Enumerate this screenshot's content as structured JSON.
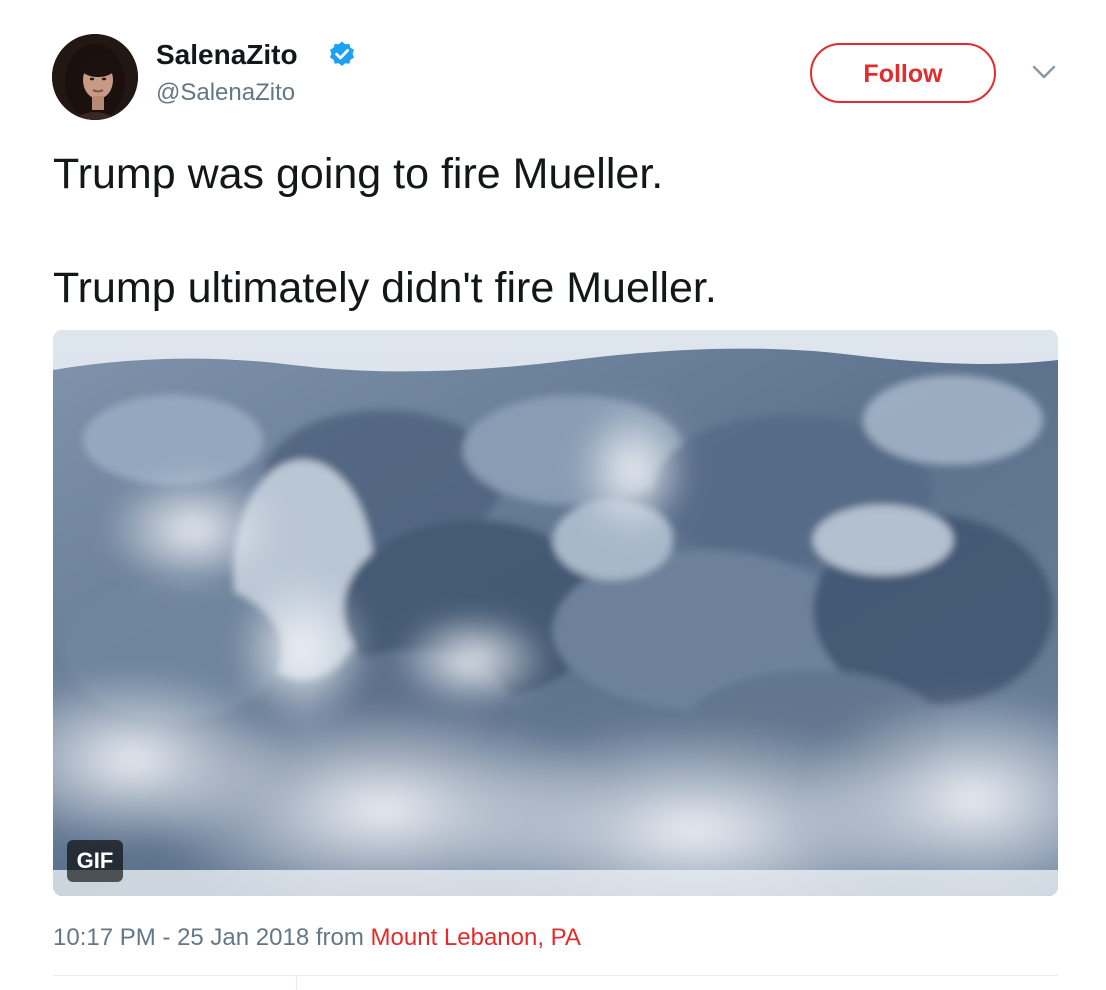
{
  "user": {
    "display_name": "SalenaZito",
    "handle": "@SalenaZito",
    "verified": true
  },
  "actions": {
    "follow_label": "Follow"
  },
  "tweet": {
    "lines": [
      "Trump was going to fire Mueller.",
      "Trump ultimately didn't fire Mueller."
    ],
    "media": {
      "badge": "GIF"
    },
    "meta": {
      "time": "10:17 PM",
      "separator": " - ",
      "date": "25 Jan 2018",
      "from": " from ",
      "location": "Mount Lebanon, PA"
    }
  },
  "colors": {
    "accent": "#e22c2c",
    "verified": "#1da1f2",
    "text": "#14171a",
    "muted": "#657786"
  },
  "icons": {
    "verified": "verified-badge-icon",
    "caret": "chevron-down-icon"
  }
}
